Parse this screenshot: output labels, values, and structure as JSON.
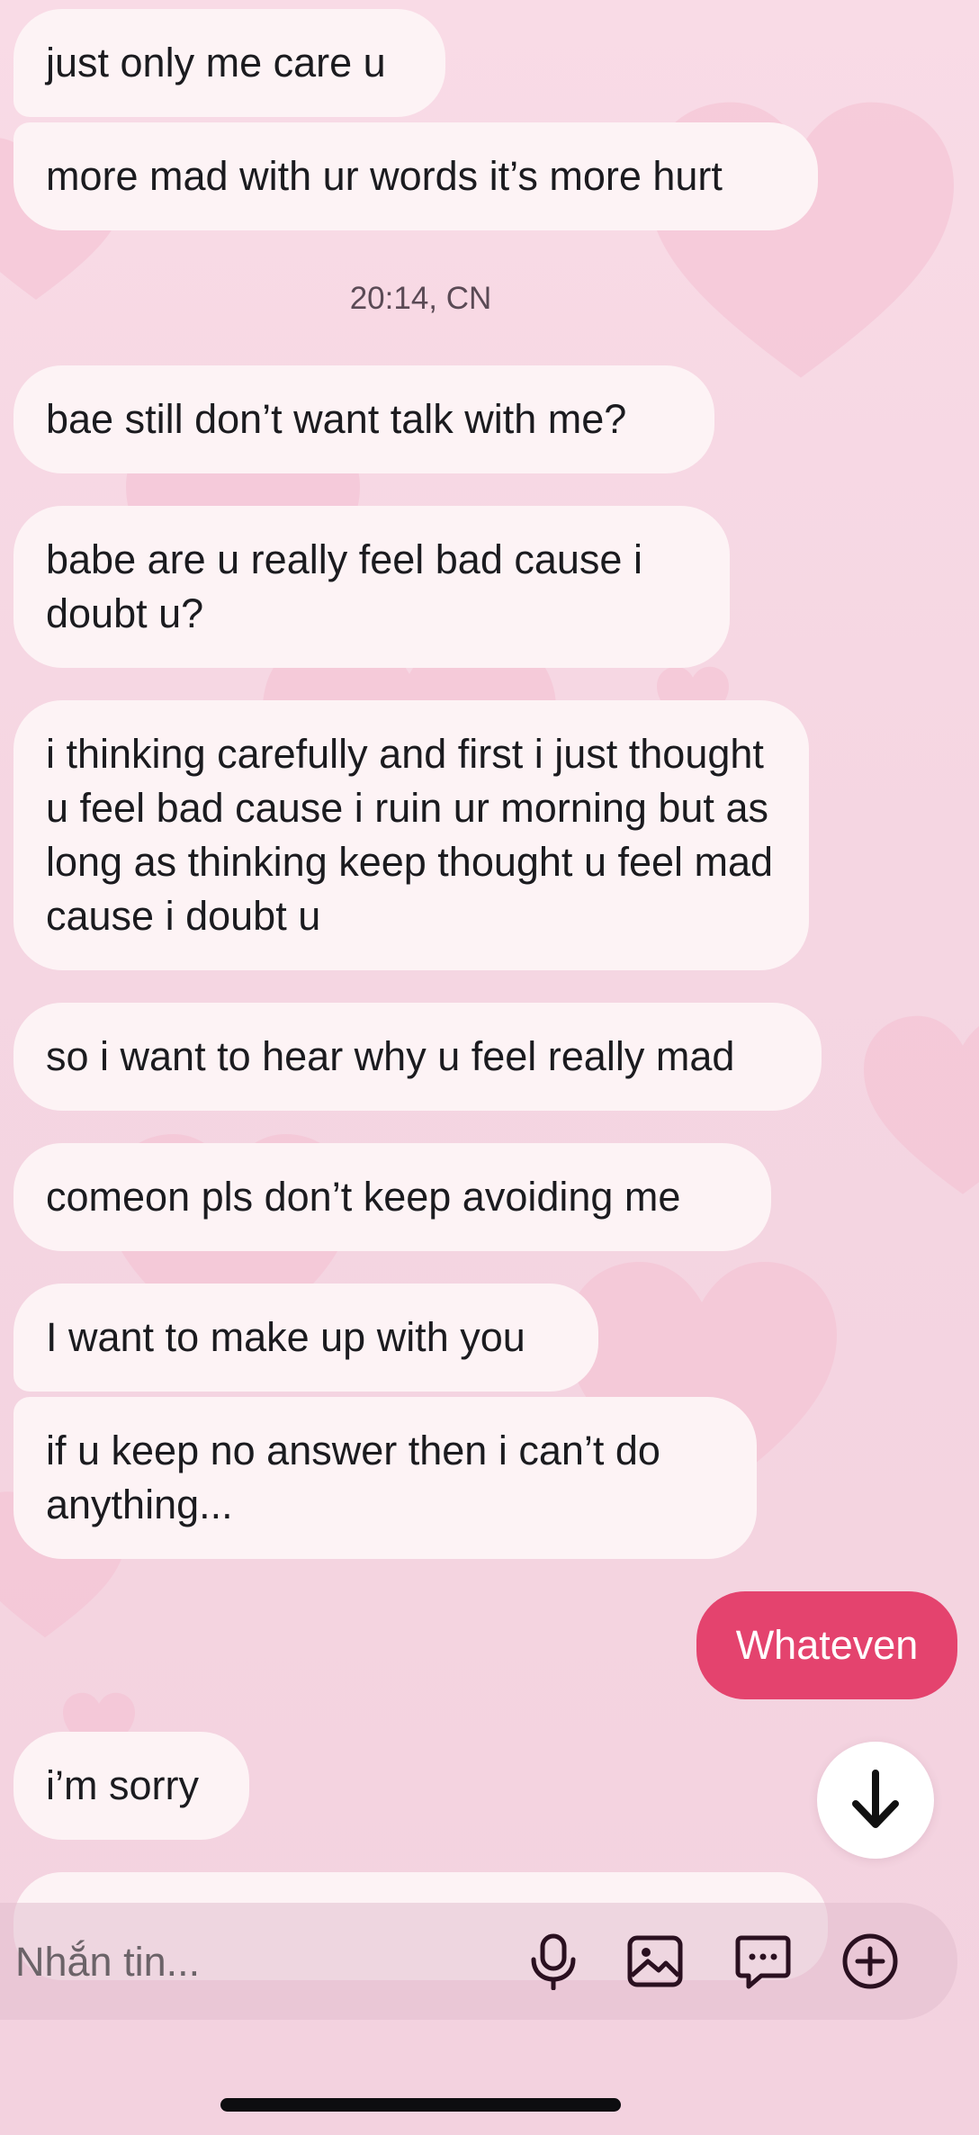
{
  "messages": [
    {
      "text": "just only me care u",
      "sender": "them"
    },
    {
      "text": "more mad with ur words it’s more hurt",
      "sender": "them"
    },
    {
      "text": "bae still don’t want talk with me?",
      "sender": "them"
    },
    {
      "text": "babe are u really feel bad cause i doubt u?",
      "sender": "them"
    },
    {
      "text": "i thinking carefully and first i just thought u feel bad cause i ruin ur morning but as long as thinking keep thought u feel mad cause i doubt u",
      "sender": "them"
    },
    {
      "text": "so i want to hear why u feel really mad",
      "sender": "them"
    },
    {
      "text": "comeon pls don’t keep avoiding me",
      "sender": "them"
    },
    {
      "text": "I want to make up with you",
      "sender": "them"
    },
    {
      "text": "if u keep no answer then i can’t do anything...",
      "sender": "them"
    },
    {
      "text": "Whateven",
      "sender": "me"
    },
    {
      "text": "i’m sorry",
      "sender": "them"
    }
  ],
  "timestamp": "20:14, CN",
  "composer": {
    "placeholder": "Nhắn tin...",
    "value": "",
    "icons": [
      "microphone-icon",
      "image-icon",
      "message-icon",
      "plus-icon"
    ]
  },
  "scroll_button": {
    "icon": "arrow-down-icon"
  },
  "colors": {
    "background": "#f5d6e2",
    "incoming_bubble": "#fdf3f5",
    "outgoing_bubble": "#e4436e",
    "text": "#1b1b1f"
  }
}
